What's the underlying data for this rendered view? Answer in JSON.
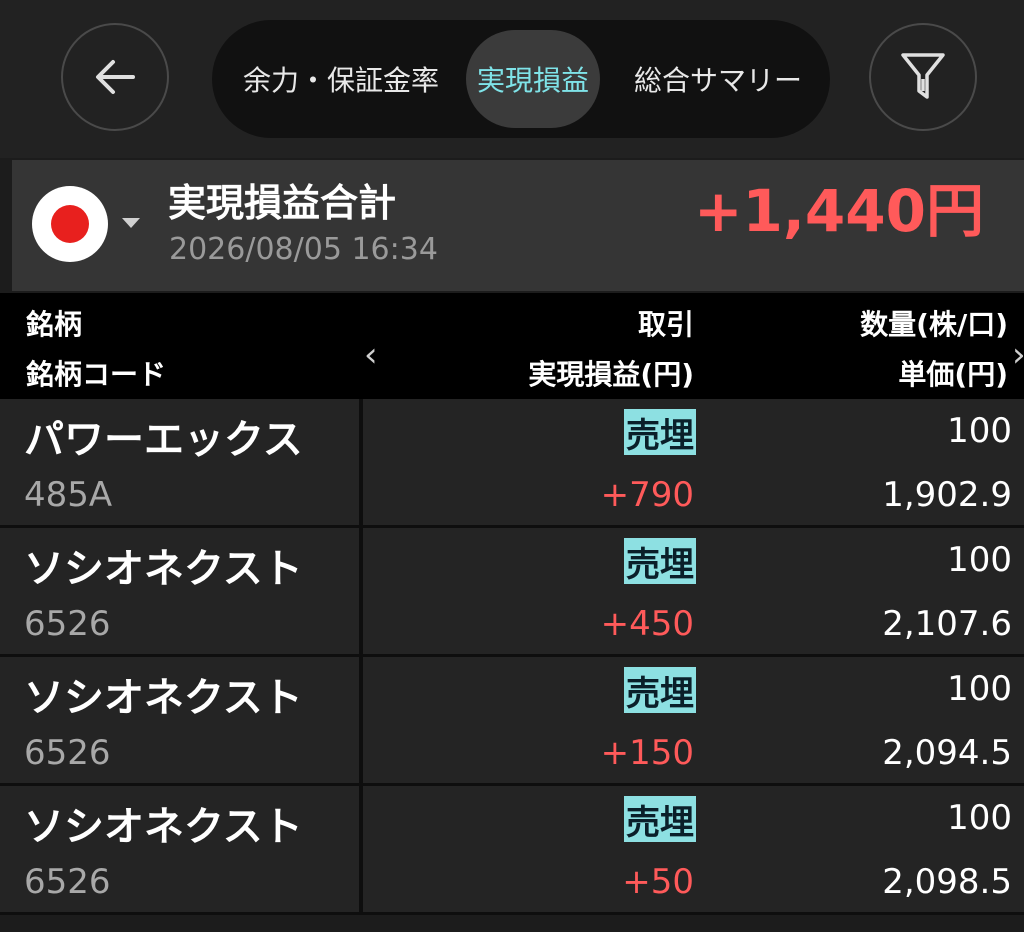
{
  "header": {
    "tabs": [
      {
        "label": "余力・保証金率",
        "active": false
      },
      {
        "label": "実現損益",
        "active": true
      },
      {
        "label": "総合サマリー",
        "active": false
      }
    ]
  },
  "summary": {
    "title": "実現損益合計",
    "timestamp": "2026/08/05 16:34",
    "total": "+1,440円"
  },
  "table": {
    "headers": {
      "name": "銘柄",
      "code": "銘柄コード",
      "trade": "取引",
      "pl": "実現損益(円)",
      "qty": "数量(株/口)",
      "price": "単価(円)"
    },
    "rows": [
      {
        "name": "パワーエックス",
        "code": "485A",
        "trade": "売埋",
        "pl": "+790",
        "qty": "100",
        "price": "1,902.9"
      },
      {
        "name": "ソシオネクスト",
        "code": "6526",
        "trade": "売埋",
        "pl": "+450",
        "qty": "100",
        "price": "2,107.6"
      },
      {
        "name": "ソシオネクスト",
        "code": "6526",
        "trade": "売埋",
        "pl": "+150",
        "qty": "100",
        "price": "2,094.5"
      },
      {
        "name": "ソシオネクスト",
        "code": "6526",
        "trade": "売埋",
        "pl": "+50",
        "qty": "100",
        "price": "2,098.5"
      }
    ]
  },
  "colors": {
    "accent_tab": "#7fe3e8",
    "profit": "#ff5a5a",
    "trade_badge": "#8de0e2"
  },
  "icons": {
    "back": "arrow-left-icon",
    "filter": "filter-icon",
    "flag": "japan-flag-icon"
  }
}
